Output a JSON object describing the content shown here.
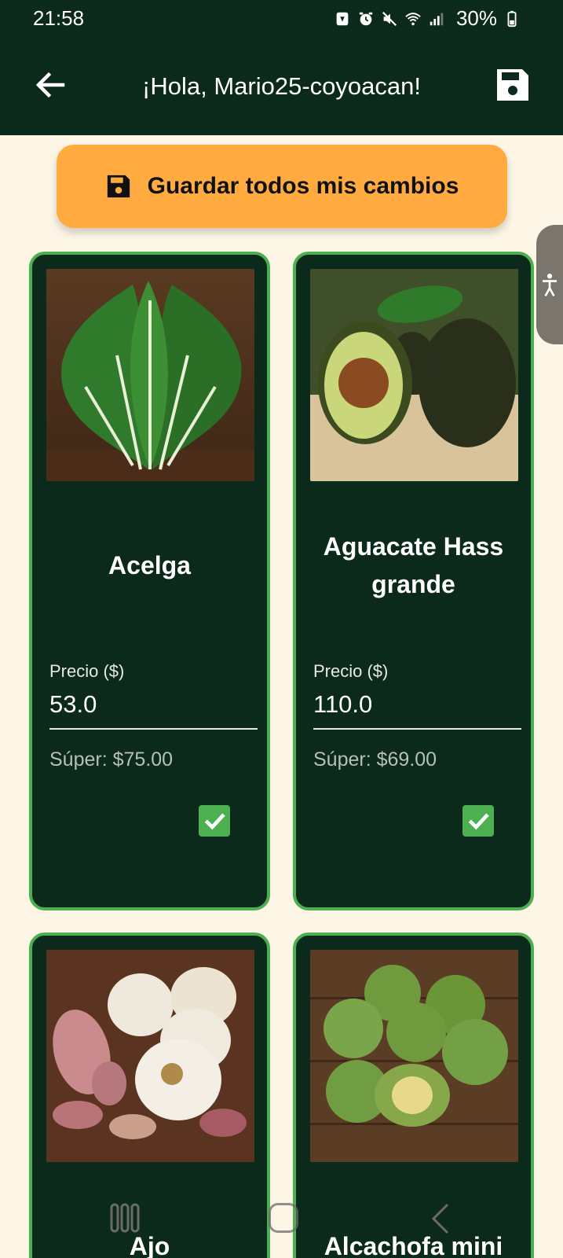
{
  "status_bar": {
    "time": "21:58",
    "battery": "30%",
    "icons": [
      "app-notification-icon",
      "alarm-icon",
      "mute-icon",
      "wifi-icon",
      "signal-icon",
      "battery-icon"
    ]
  },
  "app_bar": {
    "title": "¡Hola, Mario25-coyoacan!",
    "back_icon": "arrow-back-icon",
    "save_icon": "save-icon"
  },
  "save_all_button": {
    "label": "Guardar todos mis cambios",
    "icon": "save-icon"
  },
  "accessibility_icon": "accessibility-icon",
  "products": [
    {
      "name": "Acelga",
      "price_label": "Precio ($)",
      "price_value": "53.0",
      "super_price": "Súper: $75.00",
      "checked": true,
      "image_desc": "chard"
    },
    {
      "name": "Aguacate Hass grande",
      "price_label": "Precio ($)",
      "price_value": "110.0",
      "super_price": "Súper: $69.00",
      "checked": true,
      "image_desc": "avocado"
    },
    {
      "name": "Ajo",
      "image_desc": "garlic"
    },
    {
      "name": "Alcachofa mini",
      "image_desc": "artichoke"
    }
  ],
  "colors": {
    "app_bar": "#0b2a1b",
    "background": "#fdf6e6",
    "accent_orange": "#ffab40",
    "card_border": "#4caf50",
    "card_bg": "#0b2a1b"
  }
}
